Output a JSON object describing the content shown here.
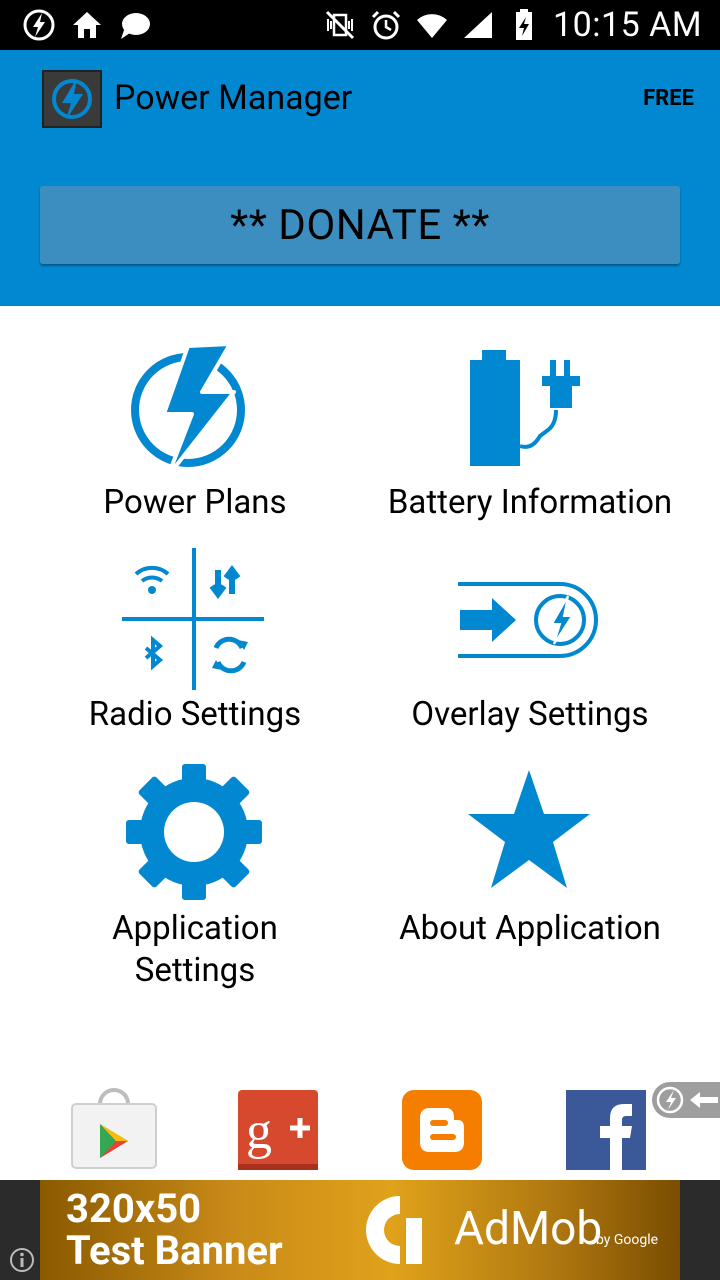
{
  "status_bar": {
    "time": "10:15 AM"
  },
  "header": {
    "title": "Power Manager",
    "edition": "FREE",
    "donate_label": "** DONATE **"
  },
  "menu": {
    "power_plans": "Power Plans",
    "battery_info": "Battery Information",
    "radio_settings": "Radio Settings",
    "overlay_settings": "Overlay Settings",
    "application_settings_line1": "Application",
    "application_settings_line2": "Settings",
    "about_application": "About Application"
  },
  "social": {
    "items": [
      "google-play",
      "google-plus",
      "blogger",
      "facebook"
    ]
  },
  "ad": {
    "line1": "320x50",
    "line2": "Test Banner",
    "brand": "AdMob",
    "by": "by Google"
  },
  "colors": {
    "accent": "#0288d1",
    "donate": "#3d8ec0"
  }
}
